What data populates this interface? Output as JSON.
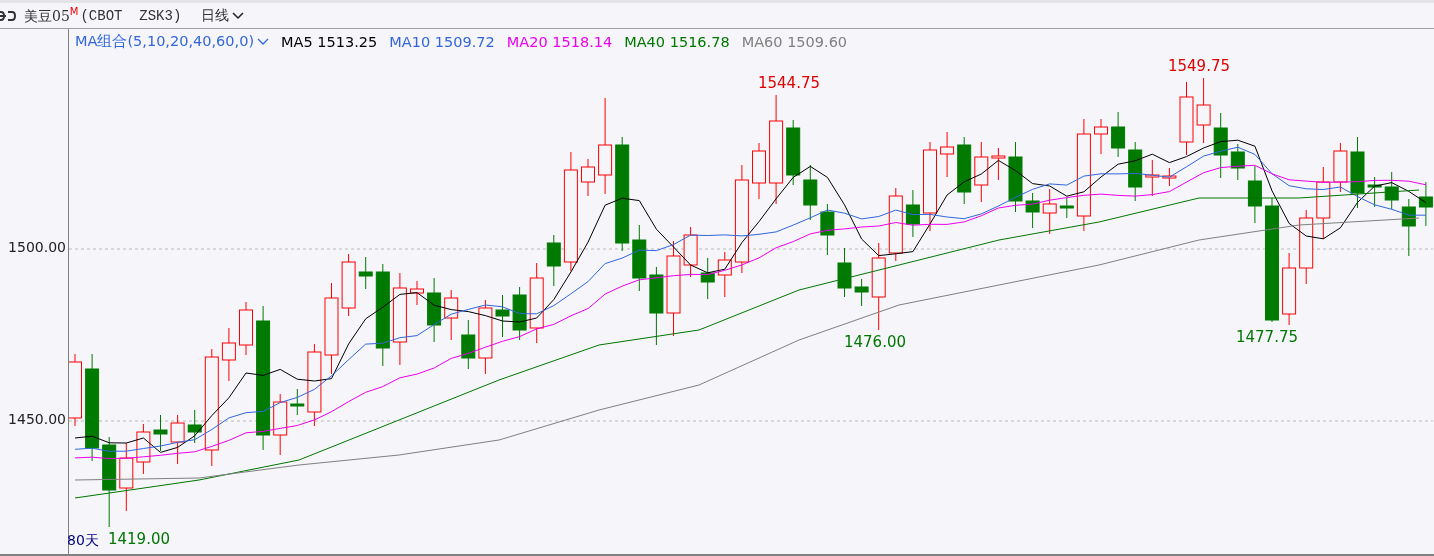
{
  "header": {
    "title": "美豆05",
    "badge": "M",
    "symbol": "(CBOT  ZSK3)",
    "period": "日线"
  },
  "indicator": {
    "name": "MA组合(5,10,20,40,60,0)",
    "values": [
      {
        "label": "MA5",
        "value": "1513.25",
        "color": "#000000"
      },
      {
        "label": "MA10",
        "value": "1509.72",
        "color": "#3366dd"
      },
      {
        "label": "MA20",
        "value": "1518.14",
        "color": "#ee00ee"
      },
      {
        "label": "MA40",
        "value": "1516.78",
        "color": "#007700"
      },
      {
        "label": "MA60",
        "value": "1509.60",
        "color": "#808080"
      }
    ]
  },
  "y_axis": {
    "ticks": [
      "1500.00",
      "1450.00"
    ]
  },
  "price_labels": [
    {
      "text": "1544.75",
      "kind": "high"
    },
    {
      "text": "1549.75",
      "kind": "high"
    },
    {
      "text": "1476.00",
      "kind": "low"
    },
    {
      "text": "1477.75",
      "kind": "low"
    },
    {
      "text": "1419.00",
      "kind": "low"
    }
  ],
  "range_label": "80天"
}
